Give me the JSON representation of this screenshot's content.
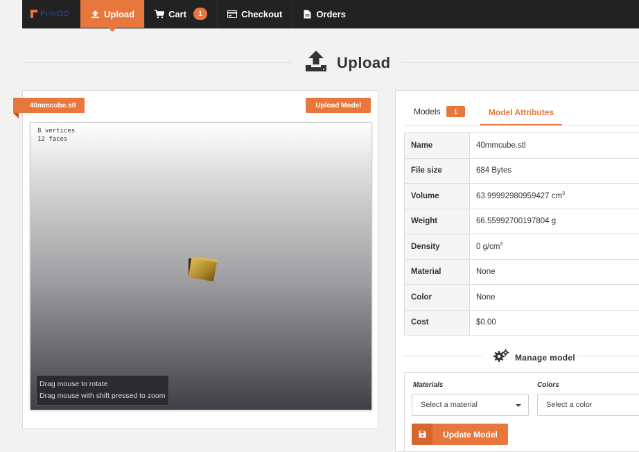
{
  "nav": {
    "brand": "Print3D",
    "items": [
      {
        "label": "Upload",
        "icon": "upload-icon",
        "active": true
      },
      {
        "label": "Cart",
        "icon": "cart-icon",
        "badge": "1"
      },
      {
        "label": "Checkout",
        "icon": "credit-card-icon"
      },
      {
        "label": "Orders",
        "icon": "document-icon"
      }
    ]
  },
  "page": {
    "title": "Upload"
  },
  "viewer": {
    "file_name": "40mmcube.stl",
    "upload_button": "Upload Model",
    "stats_vertices": "8 vertices",
    "stats_faces": "12 faces",
    "hint_rotate": "Drag mouse to rotate",
    "hint_zoom": "Drag mouse with shift pressed to zoom"
  },
  "tabs": {
    "models_label": "Models",
    "models_count": "1",
    "attributes_label": "Model Attributes"
  },
  "attributes": {
    "name_label": "Name",
    "name_value": "40mmcube.stl",
    "filesize_label": "File size",
    "filesize_value": "684 Bytes",
    "volume_label": "Volume",
    "volume_value": "63.99992980959427 cm",
    "volume_unit_sup": "3",
    "weight_label": "Weight",
    "weight_value": "66.55992700197804 g",
    "density_label": "Density",
    "density_value": "0 g/cm",
    "density_unit_sup": "3",
    "material_label": "Material",
    "material_value": "None",
    "color_label": "Color",
    "color_value": "None",
    "cost_label": "Cost",
    "cost_value": "$0.00"
  },
  "manage": {
    "title": "Manage model",
    "materials_label": "Materials",
    "materials_placeholder": "Select a material",
    "colors_label": "Colors",
    "colors_placeholder": "Select a color",
    "update_button": "Update Model"
  },
  "colors": {
    "accent": "#e8773d",
    "nav_bg": "#222222"
  }
}
